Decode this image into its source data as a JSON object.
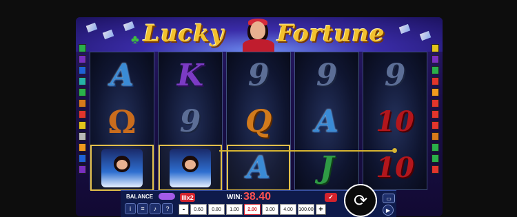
{
  "game": {
    "title_left": "Lucky",
    "title_right": "Fortune"
  },
  "reels": [
    [
      "A",
      "horseshoe",
      "gypsy"
    ],
    [
      "K",
      "9",
      "gypsy"
    ],
    [
      "9",
      "Q",
      "A"
    ],
    [
      "9",
      "A",
      "J"
    ],
    [
      "9",
      "10",
      "10"
    ]
  ],
  "winning_cells": [
    [
      0,
      2
    ],
    [
      1,
      2
    ],
    [
      2,
      2
    ]
  ],
  "line_colors": {
    "left": [
      "#2ab04a",
      "#7a2fc0",
      "#1f62d8",
      "#27b3a8",
      "#2ab04a",
      "#d87a1a",
      "#e3352c",
      "#e3c51b",
      "#b9b9b9",
      "#f09a1e",
      "#1f62d8",
      "#7a2fc0"
    ],
    "right": [
      "#e3c51b",
      "#7a2fc0",
      "#2ab04a",
      "#e3352c",
      "#f09a1e",
      "#e3352c",
      "#e3352c",
      "#e3352c",
      "#d87a1a",
      "#2ab04a",
      "#2ab04a",
      "#e3352c"
    ]
  },
  "controls": {
    "balance_label": "BALANCE",
    "multiplier_badge": "lllx2",
    "win_label": "WIN:",
    "win_value": "38.40",
    "info_icon": "info-icon",
    "menu_icon": "menu-icon",
    "sound_icon": "sound-icon",
    "help_label": "?",
    "minus_label": "-",
    "plus_label": "+",
    "bets": [
      "0.60",
      "0.80",
      "1.00",
      "2.00",
      "3.00",
      "4.00",
      "100.00"
    ],
    "selected_bet": "2.00",
    "spin_icon": "spin-icon"
  },
  "colors": {
    "accent_red": "#d4232d",
    "win_red": "#ff5151",
    "gold": "#d7b531"
  }
}
